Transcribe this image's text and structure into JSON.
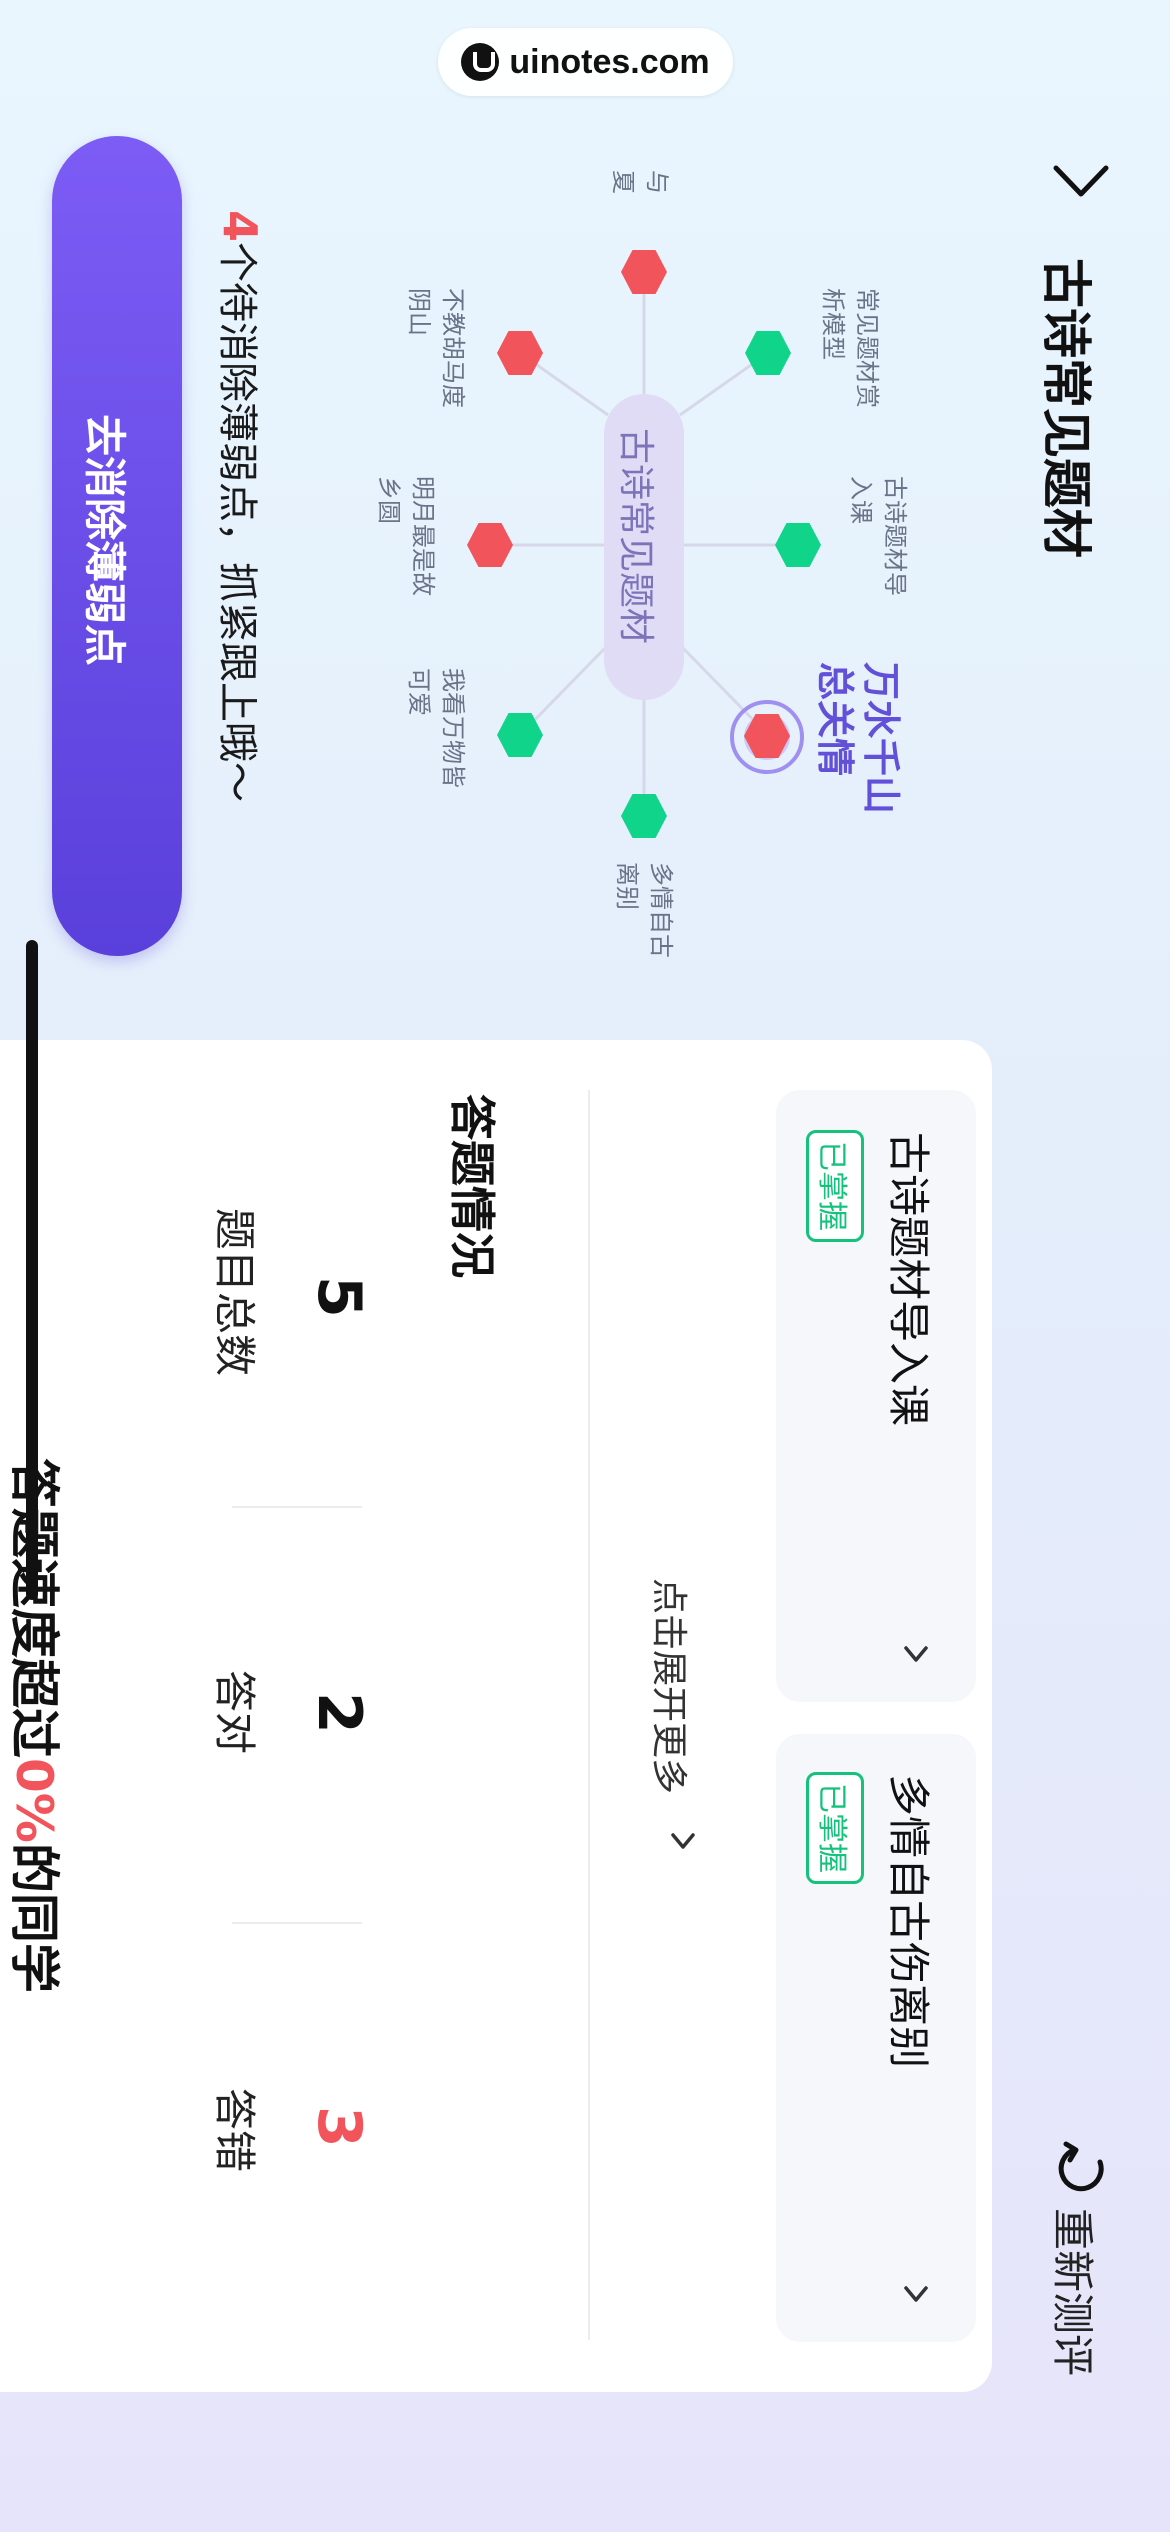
{
  "watermark": {
    "text": "uinotes.com"
  },
  "header": {
    "title": "古诗常见题材",
    "retest_label": "重新测评"
  },
  "mind_map": {
    "center": "古诗常见题材",
    "highlight": {
      "line1": "万水千山",
      "line2": "总关情"
    },
    "leaves": [
      {
        "id": "daoru",
        "line1": "古诗题材导",
        "line2": "入课",
        "status": "mastered"
      },
      {
        "id": "shangxi",
        "line1": "常见题材赏",
        "line2": "析模型",
        "status": "mastered"
      },
      {
        "id": "libie",
        "line1": "多情自古",
        "line2": "离别",
        "status": "mastered"
      },
      {
        "id": "yu",
        "line1": "与",
        "line2": "夏",
        "status": "weak"
      },
      {
        "id": "yinshan",
        "line1": "不教胡马度",
        "line2": "阴山",
        "status": "weak"
      },
      {
        "id": "guxiang",
        "line1": "明月最是故",
        "line2": "乡圆",
        "status": "weak"
      },
      {
        "id": "keai",
        "line1": "我看万物皆",
        "line2": "可爱",
        "status": "mastered"
      }
    ]
  },
  "weak_points": {
    "count": "4",
    "message": "个待消除薄弱点，抓紧跟上哦～",
    "button_label": "去消除薄弱点"
  },
  "topics": [
    {
      "title": "古诗题材导入课",
      "badge": "已掌握"
    },
    {
      "title": "多情自古伤离别",
      "badge": "已掌握"
    }
  ],
  "expand_label": "点击展开更多",
  "stats": {
    "section_title": "答题情况",
    "total": {
      "value": "5",
      "label": "题目总数"
    },
    "correct": {
      "value": "2",
      "label": "答对"
    },
    "wrong": {
      "value": "3",
      "label": "答错"
    }
  },
  "speed": {
    "prefix": "答题速度超过",
    "percent": "0%",
    "suffix": "的同学"
  },
  "colors": {
    "accent": "#6350d8",
    "button": "#6a4ee8",
    "mastered": "#15c27c",
    "weak": "#f2545b"
  }
}
